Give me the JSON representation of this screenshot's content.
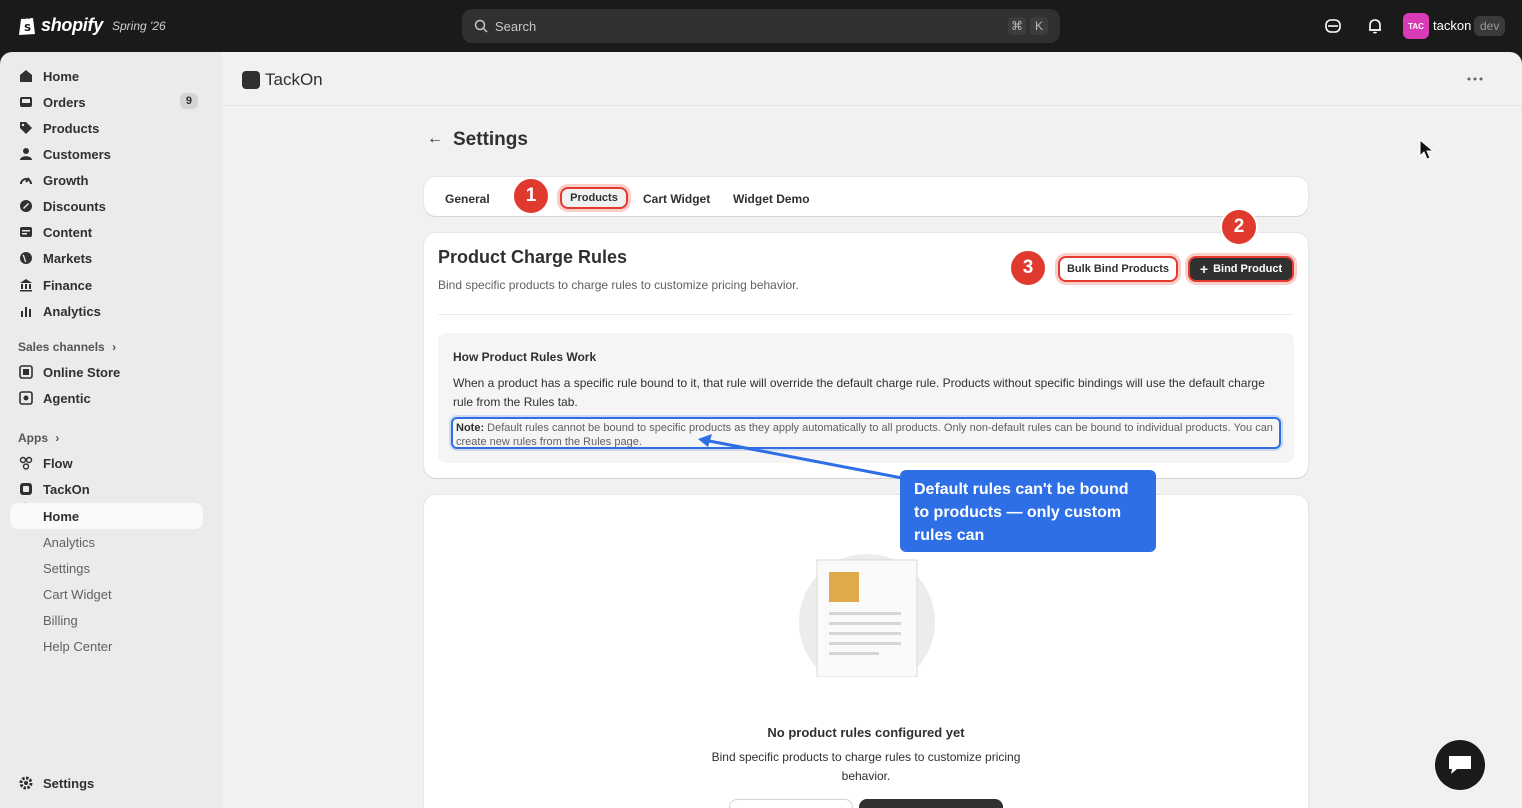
{
  "topbar": {
    "brand": "shopify",
    "edition": "Spring '26",
    "search_placeholder": "Search",
    "shortcut_cmd": "⌘",
    "shortcut_key": "K",
    "avatar_initials": "TAC",
    "store_name": "tackon",
    "env_badge": "dev"
  },
  "sidebar": {
    "items": [
      {
        "label": "Home"
      },
      {
        "label": "Orders",
        "badge": "9"
      },
      {
        "label": "Products"
      },
      {
        "label": "Customers"
      },
      {
        "label": "Growth"
      },
      {
        "label": "Discounts"
      },
      {
        "label": "Content"
      },
      {
        "label": "Markets"
      },
      {
        "label": "Finance"
      },
      {
        "label": "Analytics"
      }
    ],
    "sales_channels_label": "Sales channels",
    "sales_channels": [
      {
        "label": "Online Store"
      },
      {
        "label": "Agentic"
      }
    ],
    "apps_label": "Apps",
    "apps": [
      {
        "label": "Flow"
      },
      {
        "label": "TackOn"
      }
    ],
    "tackon_sub": [
      {
        "label": "Home"
      },
      {
        "label": "Analytics"
      },
      {
        "label": "Settings"
      },
      {
        "label": "Cart Widget"
      },
      {
        "label": "Billing"
      },
      {
        "label": "Help Center"
      }
    ],
    "settings_label": "Settings"
  },
  "app": {
    "title": "TackOn"
  },
  "page": {
    "title": "Settings",
    "tabs": [
      "General",
      "Products",
      "Cart Widget",
      "Widget Demo"
    ],
    "steps": [
      "1",
      "2",
      "3"
    ]
  },
  "rules_card": {
    "title": "Product Charge Rules",
    "subtitle": "Bind specific products to charge rules to customize pricing behavior.",
    "bulk_button": "Bulk Bind Products",
    "bind_button": "Bind Product",
    "info_title": "How Product Rules Work",
    "info_body": "When a product has a specific rule bound to it, that rule will override the default charge rule. Products without specific bindings will use the default charge rule from the Rules tab.",
    "note_label": "Note:",
    "note_text": " Default rules cannot be bound to specific products as they apply automatically to all products. Only non-default rules can be bound to individual products. You can create new rules from the Rules page."
  },
  "callout": {
    "text": "Default rules can't be bound to products — only custom rules can"
  },
  "empty_state": {
    "title": "No product rules configured yet",
    "description": "Bind specific products to charge rules to customize pricing behavior."
  },
  "colors": {
    "highlight_red": "#e63a2e",
    "highlight_blue": "#2f6fe6",
    "topbar": "#1a1a1a"
  }
}
